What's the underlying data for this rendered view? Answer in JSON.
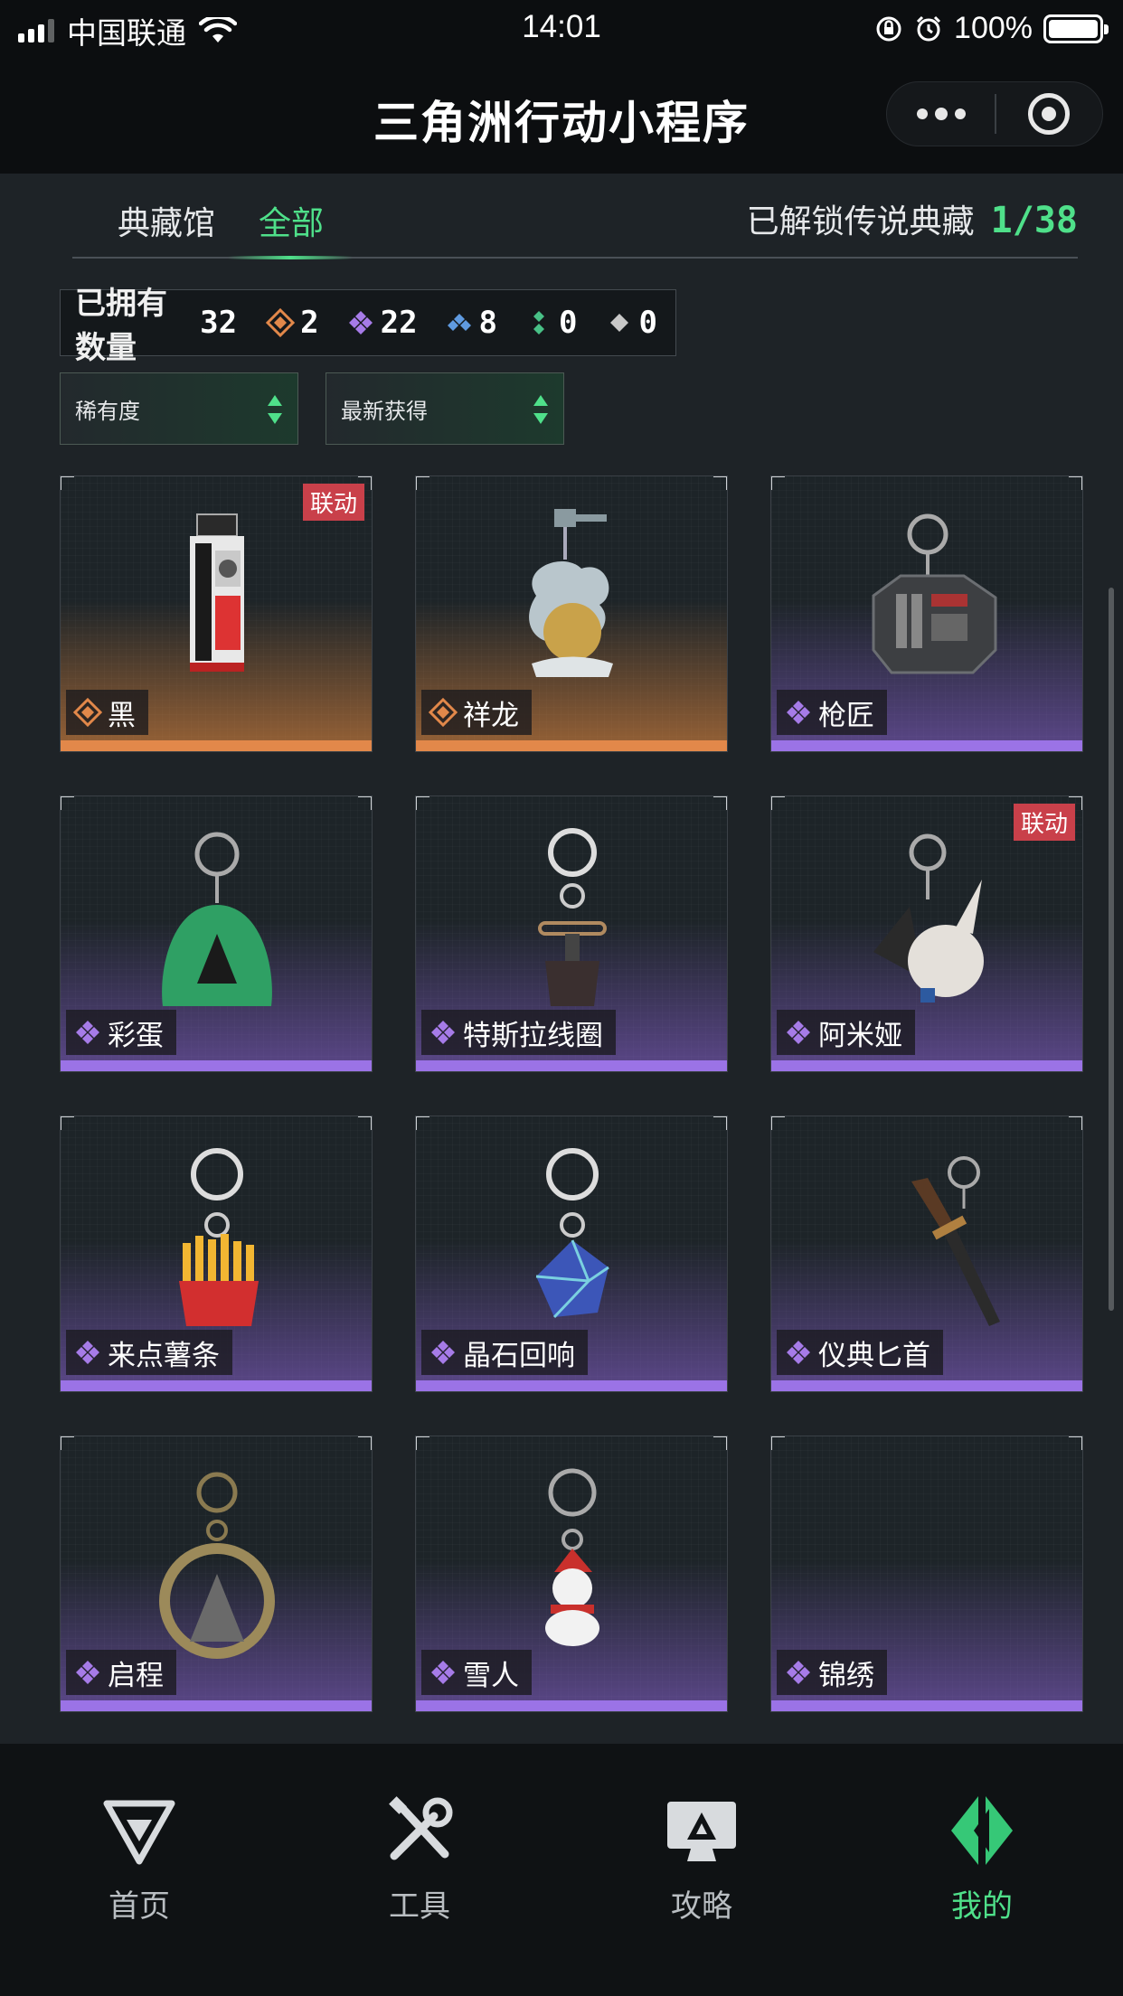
{
  "status_bar": {
    "carrier": "中国联通",
    "time": "14:01",
    "battery": "100%"
  },
  "app": {
    "title": "三角洲行动小程序"
  },
  "tabs": [
    {
      "label": "典藏馆"
    },
    {
      "label": "全部"
    }
  ],
  "unlock": {
    "label": "已解锁传说典藏",
    "count": "1/38"
  },
  "owned": {
    "label": "已拥有数量",
    "total": "32",
    "by_rarity": [
      {
        "rarity": "orange",
        "count": "2",
        "color": "#e2884a"
      },
      {
        "rarity": "purple",
        "count": "22",
        "color": "#a67be8"
      },
      {
        "rarity": "blue",
        "count": "8",
        "color": "#5f9ae0"
      },
      {
        "rarity": "green",
        "count": "0",
        "color": "#48c086"
      },
      {
        "rarity": "white",
        "count": "0",
        "color": "#c8c8c8"
      }
    ]
  },
  "filters": {
    "rarity": "稀有度",
    "sort": "最新获得"
  },
  "items": [
    {
      "name": "黑",
      "rarity": "orange",
      "tag": "联动",
      "icon": "strap-pendant-icon"
    },
    {
      "name": "祥龙",
      "rarity": "orange",
      "tag": "",
      "icon": "dragon-pendant-icon"
    },
    {
      "name": "枪匠",
      "rarity": "purple",
      "tag": "",
      "icon": "tool-case-pendant-icon"
    },
    {
      "name": "彩蛋",
      "rarity": "purple",
      "tag": "",
      "icon": "green-egg-pendant-icon"
    },
    {
      "name": "特斯拉线圈",
      "rarity": "purple",
      "tag": "",
      "icon": "tesla-coil-pendant-icon"
    },
    {
      "name": "阿米娅",
      "rarity": "purple",
      "tag": "联动",
      "icon": "rabbit-pendant-icon"
    },
    {
      "name": "来点薯条",
      "rarity": "purple",
      "tag": "",
      "icon": "fries-pendant-icon"
    },
    {
      "name": "晶石回响",
      "rarity": "purple",
      "tag": "",
      "icon": "crystal-pendant-icon"
    },
    {
      "name": "仪典匕首",
      "rarity": "purple",
      "tag": "",
      "icon": "dagger-pendant-icon"
    },
    {
      "name": "启程",
      "rarity": "purple",
      "tag": "",
      "icon": "medal-pendant-icon"
    },
    {
      "name": "雪人",
      "rarity": "purple",
      "tag": "",
      "icon": "snowman-pendant-icon"
    },
    {
      "name": "锦绣",
      "rarity": "purple",
      "tag": "",
      "icon": "empty-pendant-icon"
    }
  ],
  "bottom_nav": [
    {
      "label": "首页",
      "icon": "home-logo-icon"
    },
    {
      "label": "工具",
      "icon": "tools-icon"
    },
    {
      "label": "攻略",
      "icon": "guide-monitor-icon"
    },
    {
      "label": "我的",
      "icon": "profile-logo-icon",
      "active": true
    }
  ]
}
